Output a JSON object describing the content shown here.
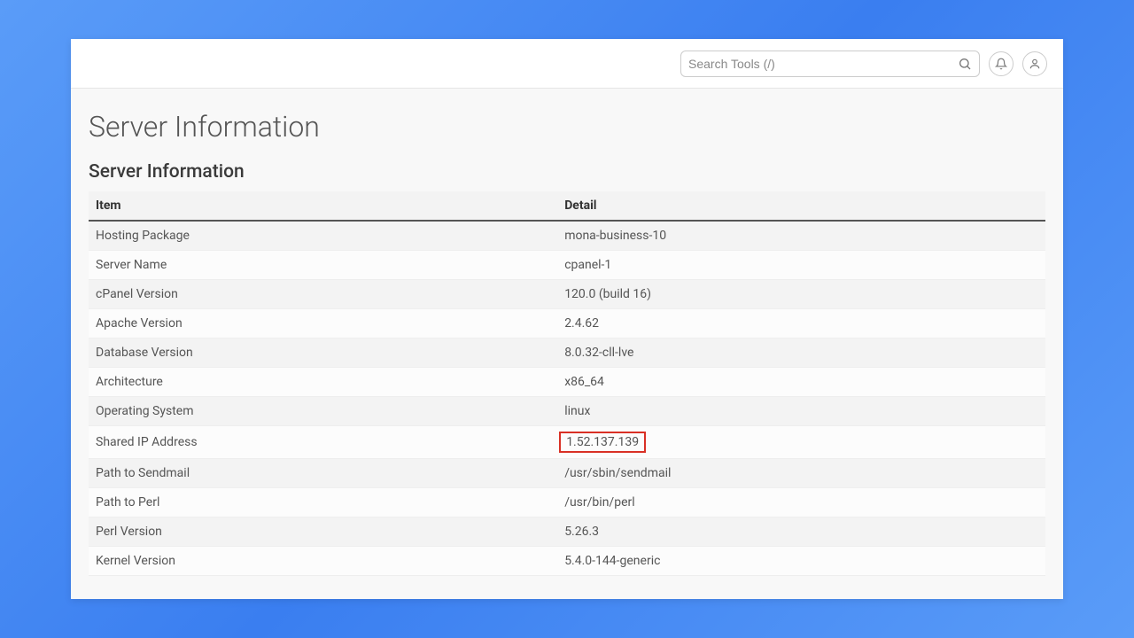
{
  "search": {
    "placeholder": "Search Tools (/)"
  },
  "page": {
    "title": "Server Information",
    "section": "Server Information"
  },
  "table": {
    "headers": {
      "item": "Item",
      "detail": "Detail"
    },
    "rows": [
      {
        "item": "Hosting Package",
        "detail": "mona-business-10"
      },
      {
        "item": "Server Name",
        "detail": "cpanel-1"
      },
      {
        "item": "cPanel Version",
        "detail": "120.0 (build 16)"
      },
      {
        "item": "Apache Version",
        "detail": "2.4.62"
      },
      {
        "item": "Database Version",
        "detail": "8.0.32-cll-lve"
      },
      {
        "item": "Architecture",
        "detail": "x86_64"
      },
      {
        "item": "Operating System",
        "detail": "linux"
      },
      {
        "item": "Shared IP Address",
        "detail": "1.52.137.139",
        "highlight": true
      },
      {
        "item": "Path to Sendmail",
        "detail": "/usr/sbin/sendmail"
      },
      {
        "item": "Path to Perl",
        "detail": "/usr/bin/perl"
      },
      {
        "item": "Perl Version",
        "detail": "5.26.3"
      },
      {
        "item": "Kernel Version",
        "detail": "5.4.0-144-generic"
      }
    ]
  }
}
